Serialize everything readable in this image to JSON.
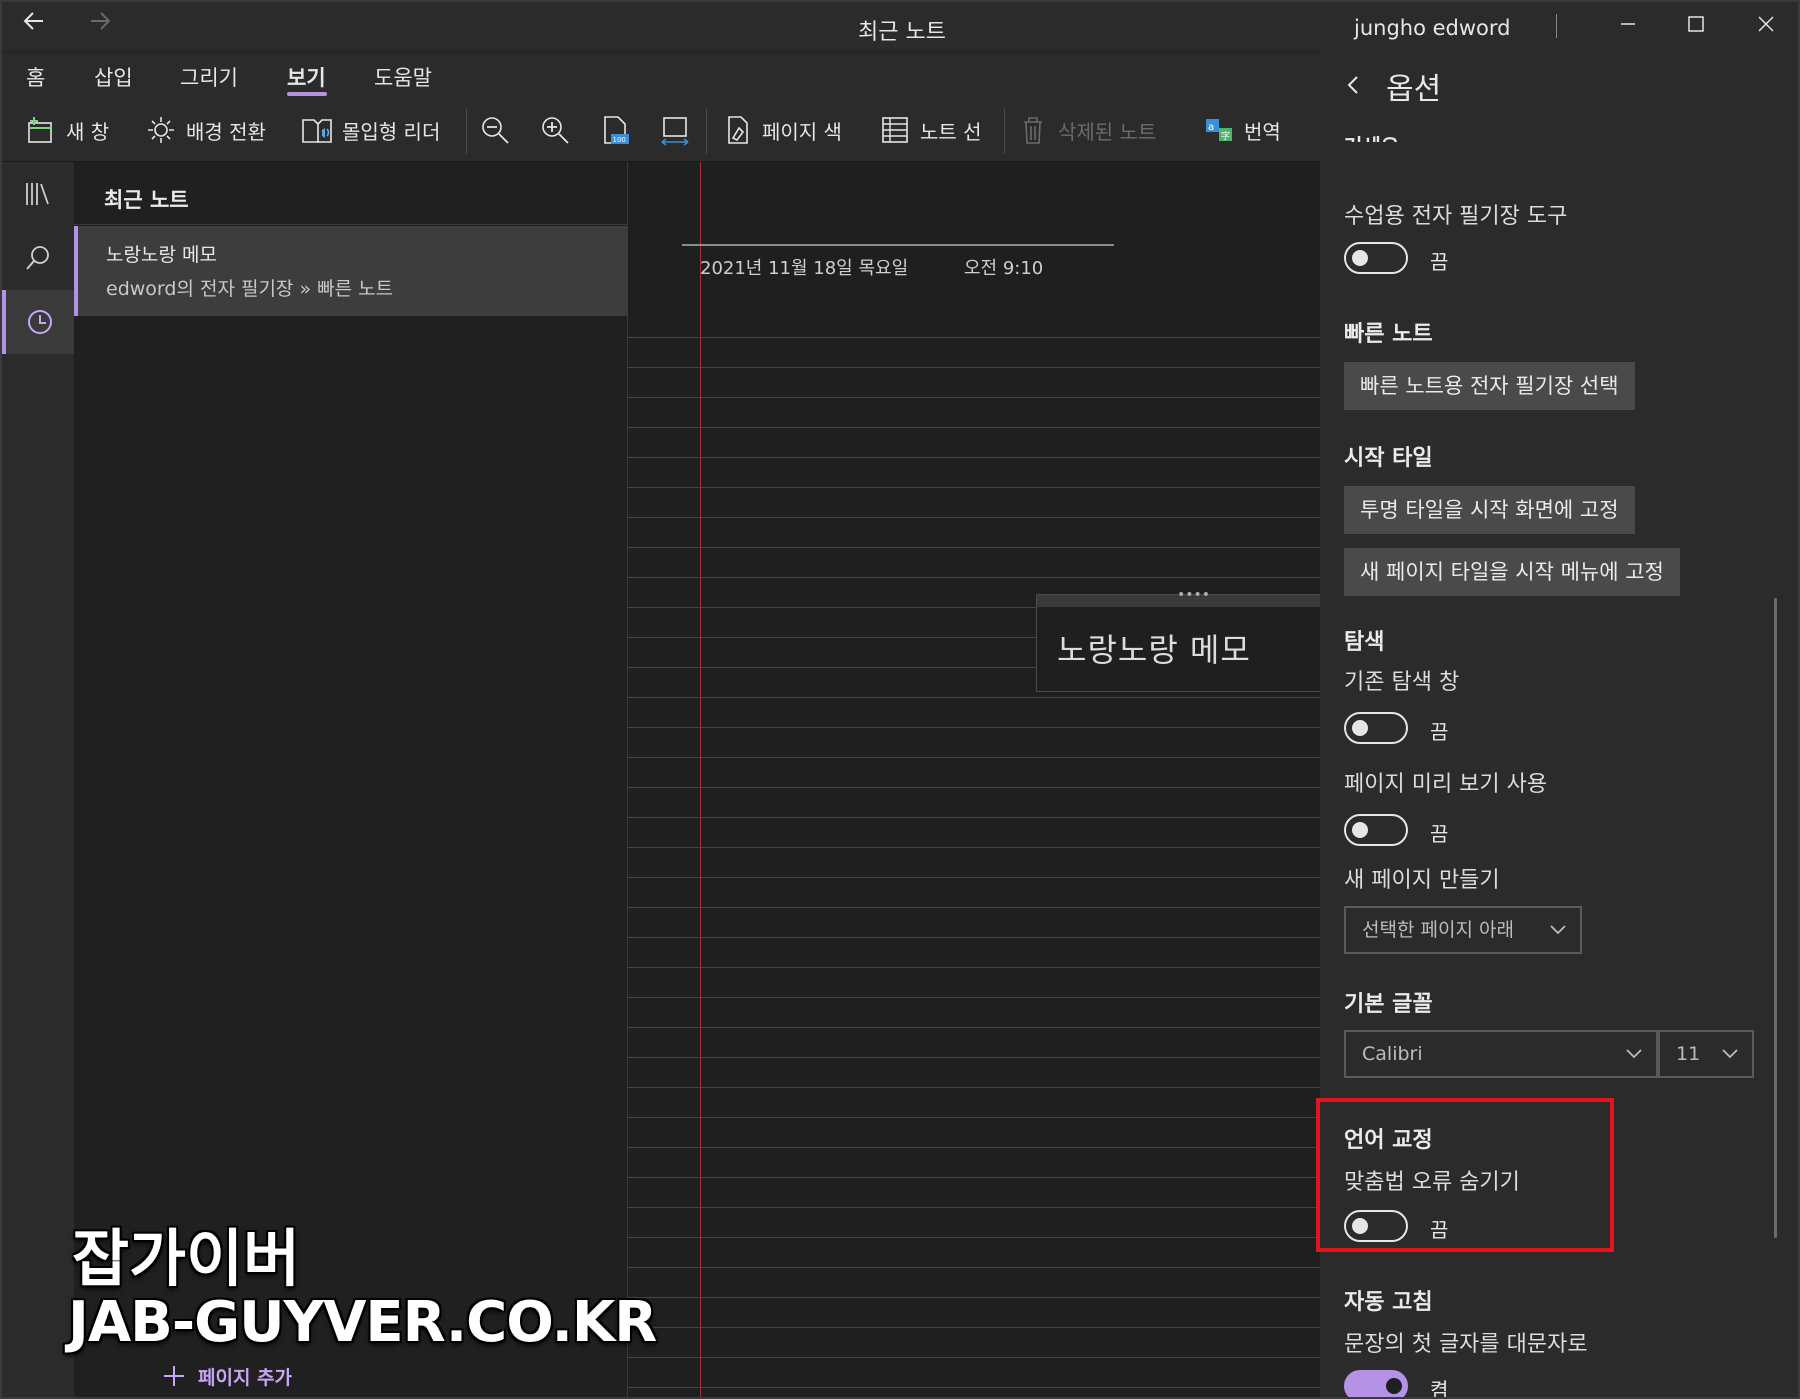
{
  "titlebar": {
    "title": "최근 노트",
    "user": "jungho edword",
    "back_icon": "arrow-left-icon",
    "forward_icon": "arrow-right-icon"
  },
  "ribbon": {
    "tabs": [
      {
        "label": "홈",
        "active": false
      },
      {
        "label": "삽입",
        "active": false
      },
      {
        "label": "그리기",
        "active": false
      },
      {
        "label": "보기",
        "active": true
      },
      {
        "label": "도움말",
        "active": false
      }
    ],
    "tools": {
      "new_window": "새 창",
      "switch_background": "배경 전환",
      "immersive_reader": "몰입형 리더",
      "page_color": "페이지 색",
      "rule_lines": "노트 선",
      "deleted_notes": "삭제된 노트",
      "translate": "번역"
    }
  },
  "notes_panel": {
    "title": "최근 노트",
    "items": [
      {
        "title": "노랑노랑 메모",
        "path": "edword의 전자 필기장 » 빠른 노트"
      }
    ],
    "add_page": "페이지 추가"
  },
  "note": {
    "date": "2021년 11월 18일 목요일",
    "time": "오전 9:10",
    "box_text": "노랑노랑 메모"
  },
  "options": {
    "header": "옵션",
    "cut_text": "거세요.",
    "classroom_label": "수업용 전자 필기장 도구",
    "classroom_state": "끔",
    "quick_notes_title": "빠른 노트",
    "quick_notes_btn": "빠른 노트용 전자 필기장 선택",
    "start_tile_title": "시작 타일",
    "start_tile_btn1": "투명 타일을 시작 화면에 고정",
    "start_tile_btn2": "새 페이지 타일을 시작 메뉴에 고정",
    "nav_title": "탐색",
    "legacy_nav_label": "기존 탐색 창",
    "legacy_nav_state": "끔",
    "page_preview_label": "페이지 미리 보기 사용",
    "page_preview_state": "끔",
    "new_page_label": "새 페이지 만들기",
    "new_page_value": "선택한 페이지 아래",
    "font_title": "기본 글꼴",
    "font_name": "Calibri",
    "font_size": "11",
    "proofing_title": "언어 교정",
    "hide_spelling_label": "맞춤법 오류 숨기기",
    "hide_spelling_state": "끔",
    "autocorrect_title": "자동 고침",
    "capitalize_label": "문장의 첫 글자를 대문자로",
    "capitalize_state": "켬"
  },
  "watermark": {
    "line1": "잡가이버",
    "line2": "JAB-GUYVER.CO.KR"
  },
  "colors": {
    "accent": "#b493e6",
    "highlight": "#e0151d",
    "margin": "#a83232",
    "rule": "#2d4a66"
  }
}
